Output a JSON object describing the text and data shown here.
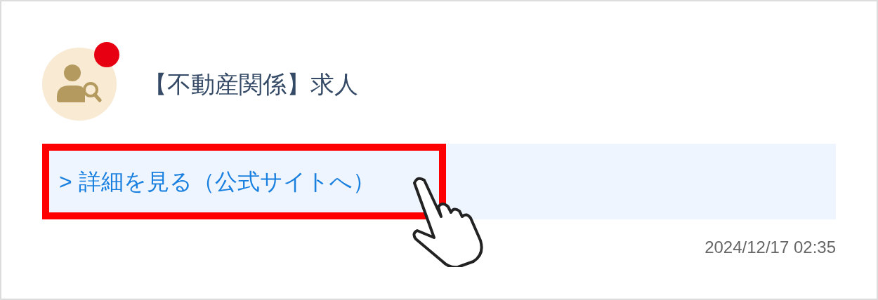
{
  "item": {
    "unread": true,
    "title": "【不動産関係】求人",
    "link": {
      "label": "> 詳細を見る（公式サイトへ）",
      "highlighted": true
    },
    "timestamp": "2024/12/17 02:35"
  }
}
